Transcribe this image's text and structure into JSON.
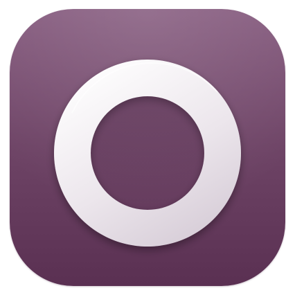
{
  "icon": {
    "name": "ring-app-icon",
    "glyph": "ring-icon",
    "colors": {
      "background_top": "#875d80",
      "background_mid": "#6e4466",
      "background_bottom": "#5a3052",
      "ring_light": "#ffffff",
      "ring_mid": "#ece6ec",
      "ring_shade": "#d5cbd6"
    }
  }
}
